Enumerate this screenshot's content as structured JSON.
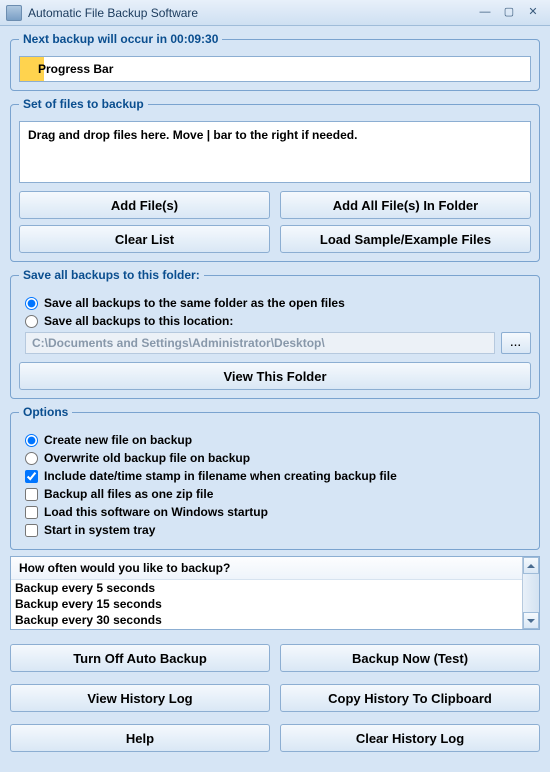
{
  "window": {
    "title": "Automatic File Backup Software"
  },
  "progress": {
    "legend": "Next backup will occur in 00:09:30",
    "label": "Progress Bar"
  },
  "fileset": {
    "legend": "Set of files to backup",
    "placeholder": "Drag and drop files here. Move | bar to the right if needed.",
    "add_files": "Add File(s)",
    "add_folder": "Add All File(s) In Folder",
    "clear": "Clear List",
    "load_sample": "Load Sample/Example Files"
  },
  "saveto": {
    "legend": "Save all backups to this folder:",
    "opt_same": "Save all backups to the same folder as the open files",
    "opt_location": "Save all backups to this location:",
    "path": "C:\\Documents and Settings\\Administrator\\Desktop\\",
    "browse": "...",
    "view": "View This Folder"
  },
  "options": {
    "legend": "Options",
    "create_new": "Create new file on backup",
    "overwrite": "Overwrite old backup file on backup",
    "datestamp": "Include date/time stamp in filename when creating backup file",
    "zip": "Backup all files as one zip file",
    "startup": "Load this software on Windows startup",
    "tray": "Start in system tray"
  },
  "frequency": {
    "header": "How often would you like to backup?",
    "items": [
      "Backup every 5 seconds",
      "Backup every 15 seconds",
      "Backup every 30 seconds"
    ]
  },
  "actions": {
    "turnoff": "Turn Off Auto Backup",
    "backup_now": "Backup Now (Test)",
    "view_log": "View History Log",
    "copy_log": "Copy History To Clipboard",
    "help": "Help",
    "clear_log": "Clear History Log"
  }
}
